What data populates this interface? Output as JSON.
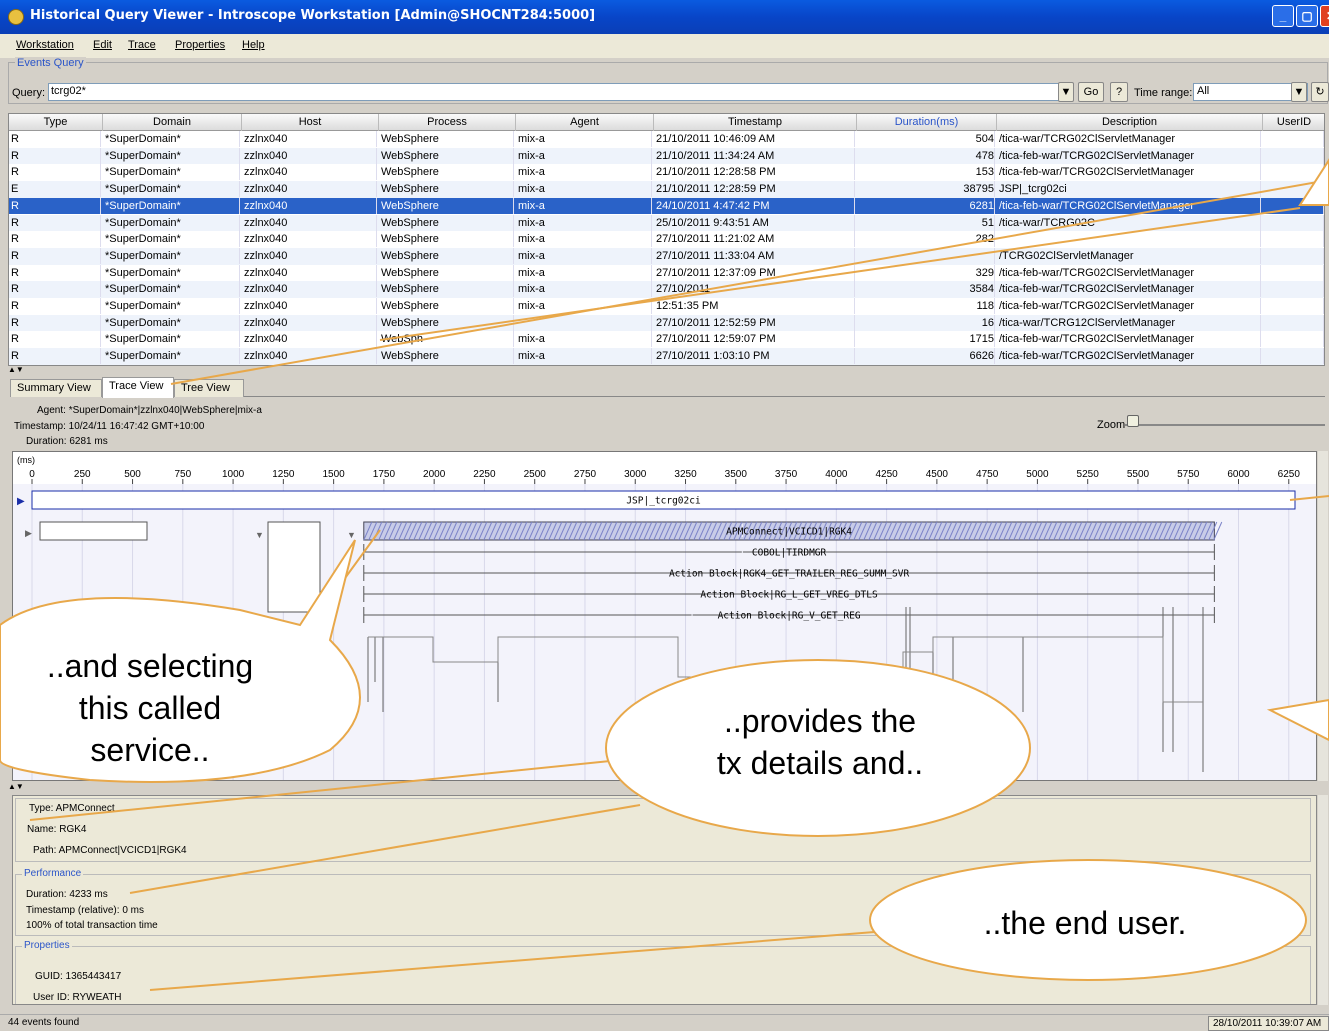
{
  "window": {
    "title": "Historical Query Viewer - Introscope Workstation [Admin@SHOCNT284:5000]"
  },
  "menu": {
    "items": [
      "Workstation",
      "Edit",
      "Trace",
      "Properties",
      "Help"
    ]
  },
  "events_query": {
    "legend": "Events Query",
    "query_label": "Query:",
    "query_value": "tcrg02*",
    "go_label": "Go",
    "help_label": "?",
    "time_range_label": "Time range:",
    "time_range_value": "All"
  },
  "table": {
    "columns": [
      "Type",
      "Domain",
      "Host",
      "Process",
      "Agent",
      "Timestamp",
      "Duration(ms)",
      "Description",
      "UserID"
    ],
    "rows": [
      [
        "R",
        "*SuperDomain*",
        "zzlnx040",
        "WebSphere",
        "mix-a",
        "21/10/2011 10:46:09 AM",
        "504",
        "/tica-war/TCRG02ClServletManager",
        ""
      ],
      [
        "R",
        "*SuperDomain*",
        "zzlnx040",
        "WebSphere",
        "mix-a",
        "21/10/2011 11:34:24 AM",
        "478",
        "/tica-feb-war/TCRG02ClServletManager",
        ""
      ],
      [
        "R",
        "*SuperDomain*",
        "zzlnx040",
        "WebSphere",
        "mix-a",
        "21/10/2011 12:28:58 PM",
        "153",
        "/tica-feb-war/TCRG02ClServletManager",
        ""
      ],
      [
        "E",
        "*SuperDomain*",
        "zzlnx040",
        "WebSphere",
        "mix-a",
        "21/10/2011 12:28:59 PM",
        "38795",
        "JSP|_tcrg02ci",
        ""
      ],
      [
        "R",
        "*SuperDomain*",
        "zzlnx040",
        "WebSphere",
        "mix-a",
        "24/10/2011 4:47:42 PM",
        "6281",
        "/tica-feb-war/TCRG02ClServletManager",
        ""
      ],
      [
        "R",
        "*SuperDomain*",
        "zzlnx040",
        "WebSphere",
        "mix-a",
        "25/10/2011 9:43:51 AM",
        "51",
        "/tica-war/TCRG02C",
        ""
      ],
      [
        "R",
        "*SuperDomain*",
        "zzlnx040",
        "WebSphere",
        "mix-a",
        "27/10/2011 11:21:02 AM",
        "282",
        "",
        ""
      ],
      [
        "R",
        "*SuperDomain*",
        "zzlnx040",
        "WebSphere",
        "mix-a",
        "27/10/2011 11:33:04 AM",
        "",
        "/TCRG02ClServletManager",
        ""
      ],
      [
        "R",
        "*SuperDomain*",
        "zzlnx040",
        "WebSphere",
        "mix-a",
        "27/10/2011 12:37:09 PM",
        "329",
        "/tica-feb-war/TCRG02ClServletManager",
        ""
      ],
      [
        "R",
        "*SuperDomain*",
        "zzlnx040",
        "WebSphere",
        "mix-a",
        "27/10/2011",
        "3584",
        "/tica-feb-war/TCRG02ClServletManager",
        ""
      ],
      [
        "R",
        "*SuperDomain*",
        "zzlnx040",
        "WebSphere",
        "mix-a",
        "12:51:35 PM",
        "118",
        "/tica-feb-war/TCRG02ClServletManager",
        ""
      ],
      [
        "R",
        "*SuperDomain*",
        "zzlnx040",
        "WebSphere",
        "",
        "27/10/2011 12:52:59 PM",
        "16",
        "/tica-war/TCRG12ClServletManager",
        ""
      ],
      [
        "R",
        "*SuperDomain*",
        "zzlnx040",
        "WebSph",
        "mix-a",
        "27/10/2011 12:59:07 PM",
        "1715",
        "/tica-feb-war/TCRG02ClServletManager",
        ""
      ],
      [
        "R",
        "*SuperDomain*",
        "zzlnx040",
        "WebSphere",
        "mix-a",
        "27/10/2011 1:03:10 PM",
        "6626",
        "/tica-feb-war/TCRG02ClServletManager",
        ""
      ]
    ],
    "selected_row": 4
  },
  "tabs": [
    "Summary View",
    "Trace View",
    "Tree View"
  ],
  "trace_info": {
    "agent": "Agent: *SuperDomain*|zzlnx040|WebSphere|mix-a",
    "timestamp": "Timestamp: 10/24/11 16:47:42 GMT+10:00",
    "duration": "Duration: 6281 ms",
    "zoom_label": "Zoom"
  },
  "trace": {
    "unit": "(ms)",
    "ticks": [
      "0",
      "250",
      "500",
      "750",
      "1000",
      "1250",
      "1500",
      "1750",
      "2000",
      "2250",
      "2500",
      "2750",
      "3000",
      "3250",
      "3500",
      "3750",
      "4000",
      "4250",
      "4500",
      "4750",
      "5000",
      "5250",
      "5500",
      "5750",
      "6000",
      "6250"
    ],
    "bars": [
      {
        "label": "JSP|_tcrg02ci",
        "start": 0,
        "end": 6281
      },
      {
        "label": "APMConnect|VCICD1|RGK4",
        "start": 1650,
        "end": 5880
      },
      {
        "label": "COBOL|TIRDMGR",
        "start": 1650,
        "end": 5880
      },
      {
        "label": "Action Block|RGK4_GET_TRAILER_REG_SUMM_SVR",
        "start": 1650,
        "end": 5880
      },
      {
        "label": "Action Block|RG_L_GET_VREG_DTLS",
        "start": 1650,
        "end": 5880
      },
      {
        "label": "Action Block|RG_V_GET_REG",
        "start": 1650,
        "end": 5880
      }
    ]
  },
  "details": {
    "type": "Type: APMConnect",
    "name": "Name: RGK4",
    "path": "Path: APMConnect|VCICD1|RGK4",
    "performance_legend": "Performance",
    "duration": "Duration: 4233 ms",
    "timestamp_rel": "Timestamp (relative): 0 ms",
    "pct": "100% of total transaction time",
    "properties_legend": "Properties",
    "guid": "GUID: 1365443417",
    "user_id": "User ID: RYWEATH"
  },
  "status": {
    "left": "44 events found",
    "right": "28/10/2011 10:39:07 AM"
  },
  "callouts": {
    "c1": [
      "..and selecting",
      "this called",
      "service.."
    ],
    "c2": [
      "..provides the",
      "tx details and.."
    ],
    "c3": [
      "..the end user."
    ]
  }
}
